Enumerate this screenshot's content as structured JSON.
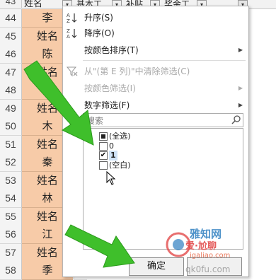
{
  "header": {
    "row_number": "43",
    "columns": [
      "姓名",
      "基本工",
      "补贴",
      "奖金工"
    ]
  },
  "rows": [
    {
      "num": "44",
      "name": "李"
    },
    {
      "num": "45",
      "name": "姓名"
    },
    {
      "num": "46",
      "name": "陈"
    },
    {
      "num": "47",
      "name": "姓名"
    },
    {
      "num": "48",
      "name": "张"
    },
    {
      "num": "49",
      "name": "姓名"
    },
    {
      "num": "50",
      "name": "木"
    },
    {
      "num": "51",
      "name": "姓名"
    },
    {
      "num": "52",
      "name": "秦"
    },
    {
      "num": "53",
      "name": "姓名"
    },
    {
      "num": "54",
      "name": "林"
    },
    {
      "num": "55",
      "name": "姓名"
    },
    {
      "num": "56",
      "name": "江"
    },
    {
      "num": "57",
      "name": "姓名"
    },
    {
      "num": "58",
      "name": "季"
    }
  ],
  "menu": {
    "sort_asc": "升序(S)",
    "sort_desc": "降序(O)",
    "sort_by_color": "按颜色排序(T)",
    "clear_filter": "从\"(第 E 列)\"中清除筛选(C)",
    "filter_by_color": "按颜色筛选(I)",
    "number_filters": "数字筛选(F)",
    "search_placeholder": "搜索",
    "list_items": [
      {
        "label": "(全选)",
        "state": "partial"
      },
      {
        "label": "0",
        "state": "unchecked"
      },
      {
        "label": "1",
        "state": "checked"
      },
      {
        "label": "(空白)",
        "state": "unchecked"
      }
    ],
    "ok_label": "确定"
  },
  "watermark": {
    "brand": "雅知网",
    "site": "爱·尬聊",
    "url": "igaliao.com",
    "url2": "qk0fu.com"
  },
  "colors": {
    "name_cell": "#f7cba8",
    "arrow": "#3fbf2b"
  }
}
